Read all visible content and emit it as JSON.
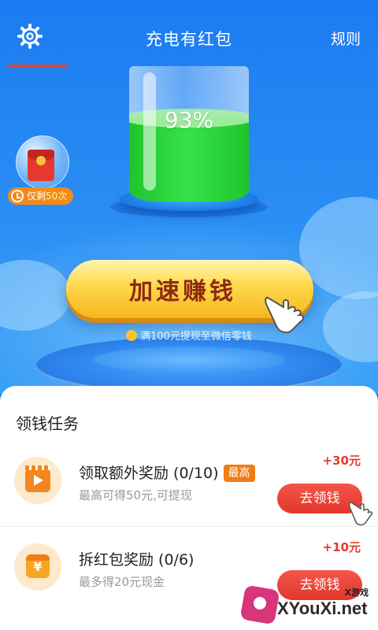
{
  "header": {
    "title": "充电有红包",
    "rules_label": "规则",
    "settings_icon": "gear-icon"
  },
  "battery": {
    "percent_text": "93%",
    "level": 0.93
  },
  "red_packet": {
    "badge_prefix": "仅剩",
    "badge_count": "50次"
  },
  "speed_button": {
    "label": "加速赚钱"
  },
  "cashout_note": "满100元提现至微信零钱",
  "tasks": {
    "title": "领钱任务",
    "items": [
      {
        "name": "领取额外奖励 (0/10)",
        "tag": "最高",
        "desc": "最高可得50元,可提现",
        "reward": "+30元",
        "button": "去领钱",
        "icon": "video-icon"
      },
      {
        "name": "拆红包奖励 (0/6)",
        "tag": "",
        "desc": "最多得20元现金",
        "reward": "+10元",
        "button": "去领钱",
        "icon": "wallet-icon"
      }
    ]
  },
  "watermark": {
    "site": "XYouXi.net",
    "label": "X游戏"
  },
  "colors": {
    "hero_blue": "#1f7ef0",
    "battery_green": "#2cd63d",
    "button_yellow": "#ffd84a",
    "button_text": "#8c2a12",
    "accent_red": "#e53b2b",
    "accent_orange": "#f07d14"
  }
}
